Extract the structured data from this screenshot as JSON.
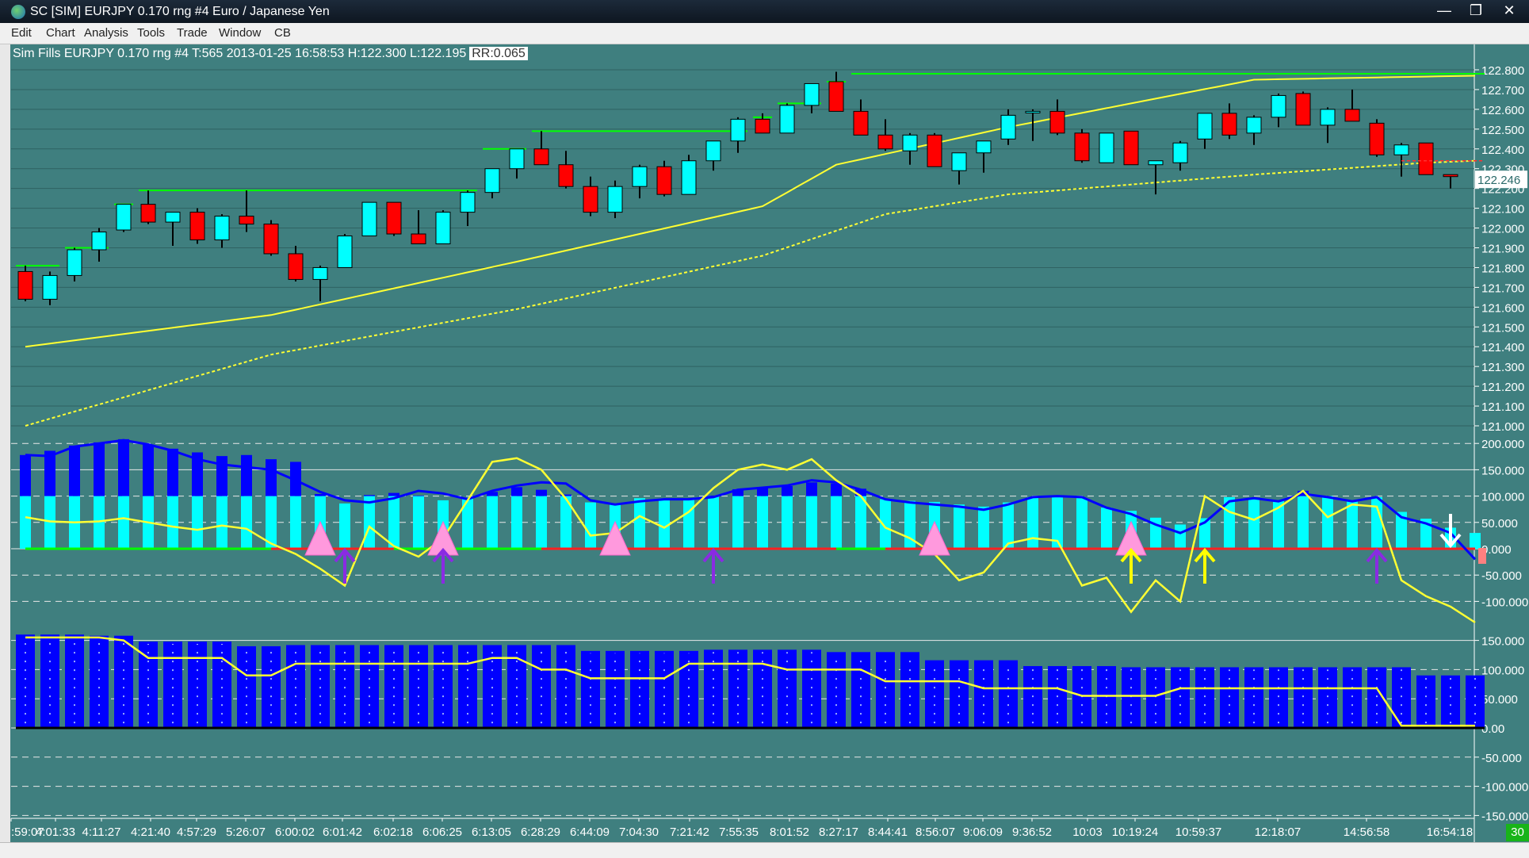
{
  "window": {
    "title": "SC [SIM] EURJPY  0.170 rng  #4  Euro / Japanese Yen",
    "min_symbol": "—",
    "max_symbol": "❐",
    "close_symbol": "✕"
  },
  "menu": {
    "items": [
      "Edit",
      "Chart",
      "Analysis",
      "Tools",
      "Trade",
      "Window",
      "CB"
    ]
  },
  "header": {
    "text": "Sim Fills  EURJPY  0.170 rng  #4 T:565 2013-01-25 16:58:53 H:122.300 L:122.195",
    "rr": "RR:0.065"
  },
  "status": {
    "counter": "30"
  },
  "colors": {
    "background": "#3f7f7f",
    "up_candle": "#00ffff",
    "down_candle": "#ff0000",
    "ma": "#ffff33",
    "bars_blue": "#0000ff",
    "resistance": "#00ff00"
  },
  "chart_data": [
    {
      "type": "candlestick",
      "panel": "price",
      "current_price": "122.246",
      "y_ticks": [
        "122.800",
        "122.700",
        "122.600",
        "122.500",
        "122.400",
        "122.300",
        "122.200",
        "122.100",
        "122.000",
        "121.900",
        "121.800",
        "121.700",
        "121.600",
        "121.500",
        "121.400",
        "121.300",
        "121.200",
        "121.100",
        "121.000"
      ],
      "ylim": [
        121.0,
        122.8
      ],
      "candles": [
        {
          "o": 121.78,
          "h": 121.81,
          "l": 121.63,
          "c": 121.64
        },
        {
          "o": 121.64,
          "h": 121.78,
          "l": 121.61,
          "c": 121.76
        },
        {
          "o": 121.76,
          "h": 121.9,
          "l": 121.73,
          "c": 121.89
        },
        {
          "o": 121.89,
          "h": 122.0,
          "l": 121.83,
          "c": 121.98
        },
        {
          "o": 121.99,
          "h": 122.12,
          "l": 121.98,
          "c": 122.12
        },
        {
          "o": 122.12,
          "h": 122.19,
          "l": 122.02,
          "c": 122.03
        },
        {
          "o": 122.03,
          "h": 122.08,
          "l": 121.91,
          "c": 122.08
        },
        {
          "o": 122.08,
          "h": 122.1,
          "l": 121.92,
          "c": 121.94
        },
        {
          "o": 121.94,
          "h": 122.07,
          "l": 121.9,
          "c": 122.06
        },
        {
          "o": 122.06,
          "h": 122.19,
          "l": 121.98,
          "c": 122.02
        },
        {
          "o": 122.02,
          "h": 122.04,
          "l": 121.86,
          "c": 121.87
        },
        {
          "o": 121.87,
          "h": 121.91,
          "l": 121.73,
          "c": 121.74
        },
        {
          "o": 121.74,
          "h": 121.81,
          "l": 121.63,
          "c": 121.8
        },
        {
          "o": 121.8,
          "h": 121.97,
          "l": 121.8,
          "c": 121.96
        },
        {
          "o": 121.96,
          "h": 122.13,
          "l": 121.96,
          "c": 122.13
        },
        {
          "o": 122.13,
          "h": 122.13,
          "l": 121.96,
          "c": 121.97
        },
        {
          "o": 121.97,
          "h": 122.09,
          "l": 121.93,
          "c": 121.92
        },
        {
          "o": 121.92,
          "h": 122.09,
          "l": 121.92,
          "c": 122.08
        },
        {
          "o": 122.08,
          "h": 122.19,
          "l": 122.01,
          "c": 122.18
        },
        {
          "o": 122.18,
          "h": 122.3,
          "l": 122.15,
          "c": 122.3
        },
        {
          "o": 122.3,
          "h": 122.4,
          "l": 122.25,
          "c": 122.4
        },
        {
          "o": 122.4,
          "h": 122.49,
          "l": 122.32,
          "c": 122.32
        },
        {
          "o": 122.32,
          "h": 122.39,
          "l": 122.2,
          "c": 122.21
        },
        {
          "o": 122.21,
          "h": 122.26,
          "l": 122.06,
          "c": 122.08
        },
        {
          "o": 122.08,
          "h": 122.24,
          "l": 122.05,
          "c": 122.21
        },
        {
          "o": 122.21,
          "h": 122.32,
          "l": 122.15,
          "c": 122.31
        },
        {
          "o": 122.31,
          "h": 122.34,
          "l": 122.16,
          "c": 122.17
        },
        {
          "o": 122.17,
          "h": 122.37,
          "l": 122.17,
          "c": 122.34
        },
        {
          "o": 122.34,
          "h": 122.44,
          "l": 122.29,
          "c": 122.44
        },
        {
          "o": 122.44,
          "h": 122.56,
          "l": 122.38,
          "c": 122.55
        },
        {
          "o": 122.55,
          "h": 122.58,
          "l": 122.48,
          "c": 122.48
        },
        {
          "o": 122.48,
          "h": 122.63,
          "l": 122.48,
          "c": 122.62
        },
        {
          "o": 122.62,
          "h": 122.73,
          "l": 122.58,
          "c": 122.73
        },
        {
          "o": 122.74,
          "h": 122.79,
          "l": 122.59,
          "c": 122.59
        },
        {
          "o": 122.59,
          "h": 122.65,
          "l": 122.47,
          "c": 122.47
        },
        {
          "o": 122.47,
          "h": 122.55,
          "l": 122.39,
          "c": 122.4
        },
        {
          "o": 122.39,
          "h": 122.48,
          "l": 122.32,
          "c": 122.47
        },
        {
          "o": 122.47,
          "h": 122.48,
          "l": 122.31,
          "c": 122.31
        },
        {
          "o": 122.29,
          "h": 122.38,
          "l": 122.22,
          "c": 122.38
        },
        {
          "o": 122.38,
          "h": 122.44,
          "l": 122.28,
          "c": 122.44
        },
        {
          "o": 122.45,
          "h": 122.6,
          "l": 122.42,
          "c": 122.57
        },
        {
          "o": 122.59,
          "h": 122.6,
          "l": 122.44,
          "c": 122.59
        },
        {
          "o": 122.59,
          "h": 122.65,
          "l": 122.47,
          "c": 122.48
        },
        {
          "o": 122.48,
          "h": 122.5,
          "l": 122.33,
          "c": 122.34
        },
        {
          "o": 122.33,
          "h": 122.48,
          "l": 122.33,
          "c": 122.48
        },
        {
          "o": 122.49,
          "h": 122.49,
          "l": 122.32,
          "c": 122.32
        },
        {
          "o": 122.32,
          "h": 122.34,
          "l": 122.17,
          "c": 122.34
        },
        {
          "o": 122.33,
          "h": 122.44,
          "l": 122.29,
          "c": 122.43
        },
        {
          "o": 122.45,
          "h": 122.58,
          "l": 122.4,
          "c": 122.58
        },
        {
          "o": 122.58,
          "h": 122.63,
          "l": 122.45,
          "c": 122.47
        },
        {
          "o": 122.48,
          "h": 122.57,
          "l": 122.42,
          "c": 122.56
        },
        {
          "o": 122.56,
          "h": 122.68,
          "l": 122.51,
          "c": 122.67
        },
        {
          "o": 122.68,
          "h": 122.69,
          "l": 122.52,
          "c": 122.52
        },
        {
          "o": 122.52,
          "h": 122.61,
          "l": 122.43,
          "c": 122.6
        },
        {
          "o": 122.6,
          "h": 122.7,
          "l": 122.54,
          "c": 122.54
        },
        {
          "o": 122.53,
          "h": 122.55,
          "l": 122.36,
          "c": 122.37
        },
        {
          "o": 122.37,
          "h": 122.43,
          "l": 122.26,
          "c": 122.42
        },
        {
          "o": 122.43,
          "h": 122.43,
          "l": 122.27,
          "c": 122.27
        },
        {
          "o": 122.27,
          "h": 122.27,
          "l": 122.2,
          "c": 122.26
        }
      ],
      "ma_fast": [
        [
          0,
          121.4
        ],
        [
          10,
          121.56
        ],
        [
          20,
          121.83
        ],
        [
          30,
          122.11
        ],
        [
          33,
          122.32
        ],
        [
          40,
          122.51
        ],
        [
          50,
          122.75
        ],
        [
          59,
          122.77
        ]
      ],
      "ma_slow": [
        [
          0,
          121.0
        ],
        [
          10,
          121.36
        ],
        [
          20,
          121.59
        ],
        [
          30,
          121.86
        ],
        [
          35,
          122.07
        ],
        [
          40,
          122.17
        ],
        [
          50,
          122.27
        ],
        [
          57,
          122.33
        ],
        [
          59,
          122.34
        ]
      ],
      "resistance_lines": [
        {
          "from": 0,
          "to": 1,
          "y": 121.81
        },
        {
          "from": 2,
          "to": 3,
          "y": 121.9
        },
        {
          "from": 4,
          "to": 4,
          "y": 122.12
        },
        {
          "from": 5,
          "to": 18,
          "y": 122.19
        },
        {
          "from": 19,
          "to": 20,
          "y": 122.4
        },
        {
          "from": 21,
          "to": 29,
          "y": 122.49
        },
        {
          "from": 30,
          "to": 30,
          "y": 122.56
        },
        {
          "from": 31,
          "to": 32,
          "y": 122.63
        },
        {
          "from": 33,
          "to": 33,
          "y": 122.74
        },
        {
          "from": 34,
          "to": 59,
          "y": 122.78
        }
      ]
    },
    {
      "type": "bar",
      "panel": "oscillator",
      "y_ticks": [
        "200.000",
        "150.000",
        "100.000",
        "50.000",
        "0.000",
        "-50.000",
        "-100.000"
      ],
      "ylim": [
        -120,
        210
      ],
      "bars": [
        178,
        186,
        196,
        202,
        208,
        198,
        190,
        183,
        176,
        178,
        170,
        165,
        104,
        86,
        102,
        106,
        101,
        92,
        97,
        108,
        117,
        112,
        103,
        88,
        86,
        96,
        92,
        94,
        101,
        113,
        117,
        119,
        126,
        124,
        114,
        94,
        91,
        89,
        84,
        80,
        88,
        98,
        100,
        96,
        78,
        72,
        59,
        46,
        58,
        98,
        95,
        92,
        110,
        100,
        90,
        98,
        70,
        57,
        40,
        30
      ],
      "blue_line": [
        178,
        176,
        194,
        200,
        206,
        198,
        186,
        170,
        160,
        155,
        150,
        130,
        108,
        92,
        88,
        96,
        110,
        105,
        94,
        110,
        120,
        126,
        124,
        92,
        84,
        90,
        94,
        94,
        98,
        112,
        116,
        120,
        130,
        126,
        112,
        94,
        88,
        84,
        80,
        74,
        84,
        98,
        100,
        98,
        78,
        66,
        46,
        30,
        50,
        90,
        96,
        90,
        104,
        98,
        90,
        98,
        60,
        48,
        30,
        -20
      ],
      "yellow_line": [
        60,
        52,
        50,
        52,
        58,
        50,
        42,
        36,
        44,
        38,
        10,
        -10,
        -38,
        -70,
        42,
        5,
        -15,
        20,
        92,
        165,
        172,
        150,
        95,
        25,
        30,
        62,
        40,
        70,
        115,
        150,
        160,
        150,
        170,
        130,
        100,
        40,
        20,
        -10,
        -60,
        -45,
        10,
        20,
        15,
        -70,
        -55,
        -120,
        -60,
        -100,
        100,
        70,
        55,
        78,
        110,
        60,
        84,
        80,
        -60,
        -90,
        -110,
        -140
      ],
      "zero_line_segments": [
        {
          "from": 0,
          "to": 10,
          "color": "#00ff00"
        },
        {
          "from": 10,
          "to": 15,
          "color": "#ff2020"
        },
        {
          "from": 15,
          "to": 21,
          "color": "#00ff00"
        },
        {
          "from": 21,
          "to": 33,
          "color": "#ff2020"
        },
        {
          "from": 33,
          "to": 35,
          "color": "#00ff00"
        },
        {
          "from": 35,
          "to": 59,
          "color": "#ff2020"
        }
      ],
      "markers": [
        {
          "i": 12,
          "kind": "pink-triangle"
        },
        {
          "i": 13,
          "kind": "purple-arrow-up"
        },
        {
          "i": 17,
          "kind": "pink-triangle"
        },
        {
          "i": 17,
          "kind": "purple-arrow-up"
        },
        {
          "i": 24,
          "kind": "pink-triangle"
        },
        {
          "i": 28,
          "kind": "purple-arrow-up"
        },
        {
          "i": 37,
          "kind": "pink-triangle"
        },
        {
          "i": 45,
          "kind": "pink-triangle"
        },
        {
          "i": 45,
          "kind": "yellow-arrow-up"
        },
        {
          "i": 48,
          "kind": "yellow-arrow-up"
        },
        {
          "i": 55,
          "kind": "purple-arrow-up"
        },
        {
          "i": 58,
          "kind": "white-arrow-down"
        }
      ]
    },
    {
      "type": "bar",
      "panel": "lower",
      "y_ticks": [
        "150.000",
        "100.000",
        "50.000",
        "0.00",
        "-50.000",
        "-100.000",
        "-150.000"
      ],
      "ylim": [
        -150,
        160
      ],
      "bars": [
        160,
        160,
        160,
        158,
        158,
        148,
        148,
        148,
        148,
        140,
        140,
        142,
        142,
        142,
        142,
        142,
        142,
        142,
        142,
        142,
        142,
        142,
        142,
        132,
        132,
        132,
        132,
        132,
        134,
        134,
        134,
        134,
        134,
        130,
        130,
        130,
        130,
        116,
        116,
        116,
        116,
        106,
        106,
        106,
        106,
        104,
        104,
        104,
        104,
        104,
        104,
        104,
        104,
        104,
        104,
        104,
        104,
        90,
        90,
        90
      ],
      "line": [
        155,
        155,
        155,
        155,
        150,
        120,
        120,
        120,
        120,
        90,
        90,
        110,
        110,
        110,
        110,
        110,
        110,
        110,
        110,
        120,
        120,
        100,
        100,
        85,
        85,
        85,
        85,
        110,
        110,
        110,
        110,
        100,
        100,
        100,
        100,
        80,
        80,
        80,
        80,
        68,
        68,
        68,
        68,
        55,
        55,
        55,
        55,
        68,
        68,
        68,
        68,
        68,
        68,
        68,
        68,
        68,
        4,
        4,
        4,
        4
      ]
    }
  ],
  "x_ticks": [
    ":59:07",
    "4:01:33",
    "4:11:27",
    "4:21:40",
    "4:57:29",
    "5:26:07",
    "6:00:02",
    "6:01:42",
    "6:02:18",
    "6:06:25",
    "6:13:05",
    "6:28:29",
    "6:44:09",
    "7:04:30",
    "7:21:42",
    "7:55:35",
    "8:01:52",
    "8:27:17",
    "8:44:41",
    "8:56:07",
    "9:06:09",
    "9:36:52",
    "10:03",
    "10:19:24",
    "10:59:37",
    "12:18:07",
    "14:56:58",
    "16:54:18"
  ]
}
